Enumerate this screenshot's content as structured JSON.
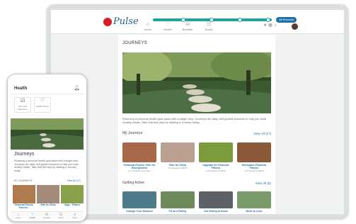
{
  "tablet": {
    "app_name": "Pulse",
    "badge": "All Rewards",
    "nav": [
      {
        "label": "Home",
        "icon": "home-icon",
        "glyph": "⌂"
      },
      {
        "label": "Health",
        "icon": "heart-icon",
        "glyph": "♡"
      },
      {
        "label": "Benefits",
        "icon": "rewards-icon",
        "glyph": "⛁"
      },
      {
        "label": "Social",
        "icon": "social-icon",
        "glyph": "☷"
      }
    ],
    "page_title": "JOURNEYS",
    "hero_text": "Reaching a personal health goal starts with a single step. Journeys are daily, self-guided sessions to help you build healthy habits. Take that first step by starting a Journey today.",
    "my_journeys": {
      "title": "My Journeys",
      "view_all": "View All (17)",
      "cards": [
        {
          "name": "Financial Fitness: Plan for Emergencies",
          "sub": "2 of 10 Steps Complete",
          "color": "#a8694a"
        },
        {
          "name": "Plan for Sleep",
          "sub": "Completed 1/1/2020",
          "color": "#b9a090"
        },
        {
          "name": "Upgrade for Financial Fitness",
          "sub": "Completed 1/1/2020",
          "color": "#7c9c3c"
        },
        {
          "name": "Workplace Financial Fitness",
          "sub": "Completed 1/1/2020",
          "color": "#8a5a3a"
        }
      ]
    },
    "getting_active": {
      "title": "Getting Active",
      "view_all": "View All (5)",
      "cards": [
        {
          "name": "Change Your Workout",
          "color": "#4d7a8c"
        },
        {
          "name": "Fit as a Family",
          "color": "#6f8a5a"
        },
        {
          "name": "Get Strong at Home",
          "color": "#5c6268"
        },
        {
          "name": "Move to Lose",
          "color": "#7a9a6a"
        }
      ]
    }
  },
  "phone": {
    "title": "Health",
    "tiles": [
      {
        "label": "Set Goal Education",
        "icon": "goal-icon",
        "glyph": "☑"
      },
      {
        "label": "Health Check",
        "icon": "health-check-icon",
        "glyph": "♡"
      }
    ],
    "journeys_title": "Journeys",
    "description": "Reaching a personal health goal starts with a single step. Journeys are daily, self-guided sessions to help you build healthy habits. Take that first step by starting a Journey today.",
    "section": "MY JOURNEYS",
    "view_all": "View All (17)",
    "cards": [
      {
        "name": "Financial Fitness: Plan for...",
        "color": "#b07a4f"
      },
      {
        "name": "Plan for Sleep",
        "color": "#a38a7a"
      },
      {
        "name": "Upgr... Fitness",
        "color": "#8aa04a"
      }
    ],
    "bottom_nav": [
      {
        "label": "Home",
        "glyph": "⌂"
      },
      {
        "label": "Health",
        "glyph": "♡"
      },
      {
        "label": "Benefits",
        "glyph": "⛁"
      },
      {
        "label": "Social",
        "glyph": "☷"
      },
      {
        "label": "More",
        "glyph": "≡"
      }
    ]
  },
  "colors": {
    "accent": "#20a39e",
    "link": "#1d6fa5",
    "brand_red": "#d61f26"
  }
}
